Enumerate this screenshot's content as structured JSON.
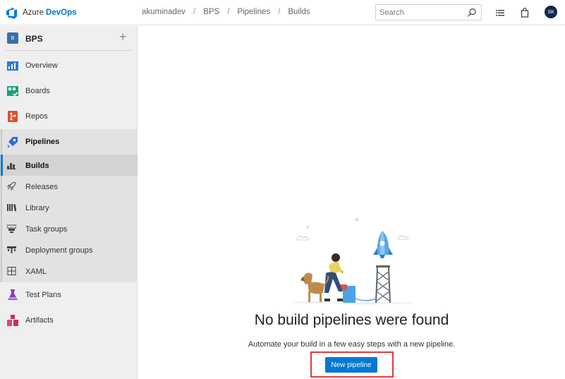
{
  "brand": {
    "name": "Azure",
    "product": "DevOps"
  },
  "breadcrumb": [
    "akuminadev",
    "BPS",
    "Pipelines",
    "Builds"
  ],
  "search": {
    "placeholder": "Search"
  },
  "user": {
    "initials": "SK"
  },
  "project": {
    "badge": "B",
    "name": "BPS"
  },
  "nav": {
    "overview": "Overview",
    "boards": "Boards",
    "repos": "Repos",
    "pipelines": "Pipelines",
    "test_plans": "Test Plans",
    "artifacts": "Artifacts"
  },
  "pipelines_sub": {
    "builds": "Builds",
    "releases": "Releases",
    "library": "Library",
    "task_groups": "Task groups",
    "deployment_groups": "Deployment groups",
    "xaml": "XAML"
  },
  "empty_state": {
    "title": "No build pipelines were found",
    "subtitle": "Automate your build in a few easy steps with a new pipeline.",
    "button": "New pipeline"
  },
  "colors": {
    "accent": "#0078d4",
    "highlight": "#e03c3c",
    "avatar": "#0b2a4a"
  }
}
